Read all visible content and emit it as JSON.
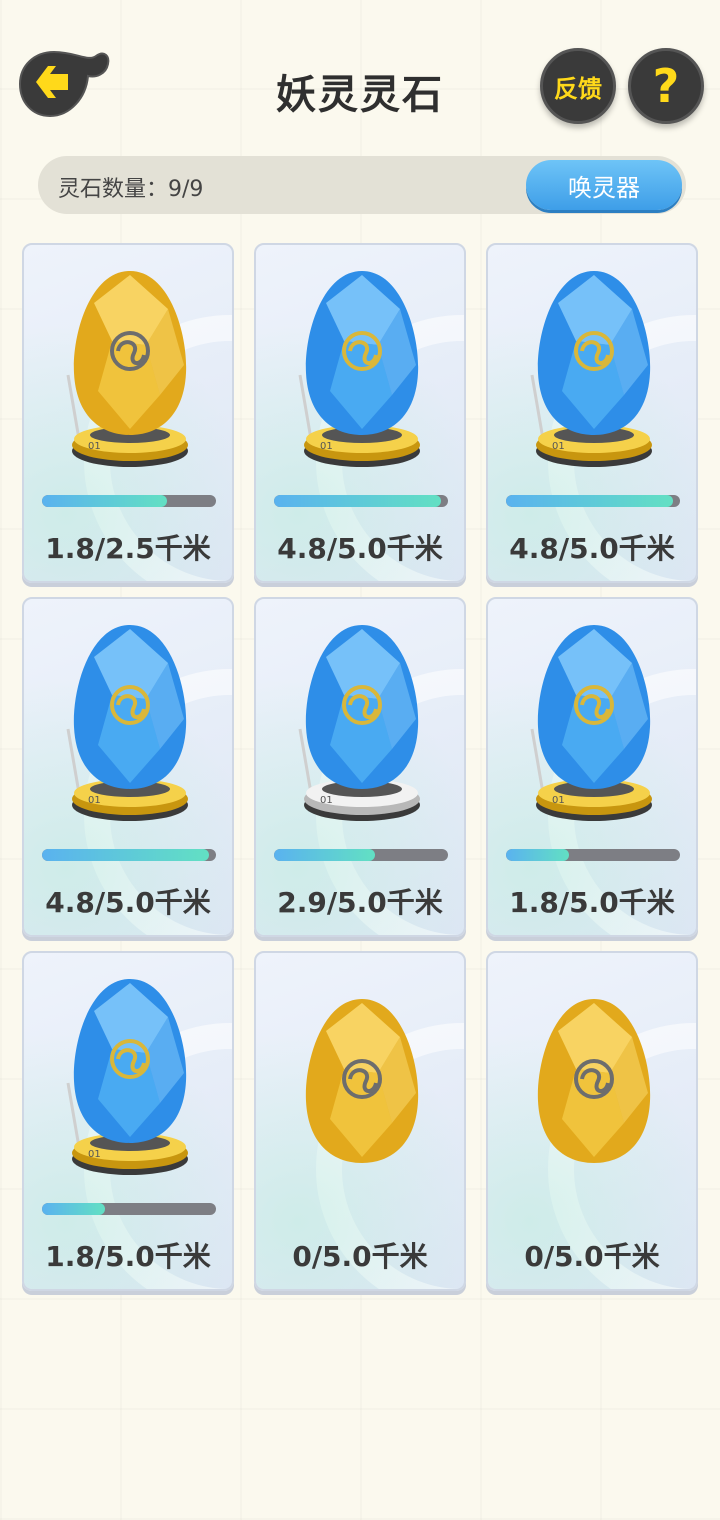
{
  "header": {
    "title": "妖灵灵石",
    "feedback_label": "反馈",
    "help_label": "?"
  },
  "count_bar": {
    "label": "灵石数量：9/9",
    "summon_label": "唤灵器"
  },
  "colors": {
    "gold_egg": "#f3c63a",
    "blue_egg": "#3fa6f2",
    "progress_start": "#5ab2ef",
    "progress_end": "#62e0c3",
    "track": "#7d7e84"
  },
  "stones": [
    {
      "type": "gold",
      "on_stand": true,
      "stand": "gold",
      "progress": 0.72,
      "distance": "1.8/2.5千米"
    },
    {
      "type": "blue",
      "on_stand": true,
      "stand": "gold",
      "progress": 0.96,
      "distance": "4.8/5.0千米"
    },
    {
      "type": "blue",
      "on_stand": true,
      "stand": "gold",
      "progress": 0.96,
      "distance": "4.8/5.0千米"
    },
    {
      "type": "blue",
      "on_stand": true,
      "stand": "gold",
      "progress": 0.96,
      "distance": "4.8/5.0千米"
    },
    {
      "type": "blue",
      "on_stand": true,
      "stand": "silver",
      "progress": 0.58,
      "distance": "2.9/5.0千米"
    },
    {
      "type": "blue",
      "on_stand": true,
      "stand": "gold",
      "progress": 0.36,
      "distance": "1.8/5.0千米"
    },
    {
      "type": "blue",
      "on_stand": true,
      "stand": "gold",
      "progress": 0.36,
      "distance": "1.8/5.0千米"
    },
    {
      "type": "gold",
      "on_stand": false,
      "stand": "",
      "progress": 0,
      "distance": "0/5.0千米"
    },
    {
      "type": "gold",
      "on_stand": false,
      "stand": "",
      "progress": 0,
      "distance": "0/5.0千米"
    }
  ]
}
